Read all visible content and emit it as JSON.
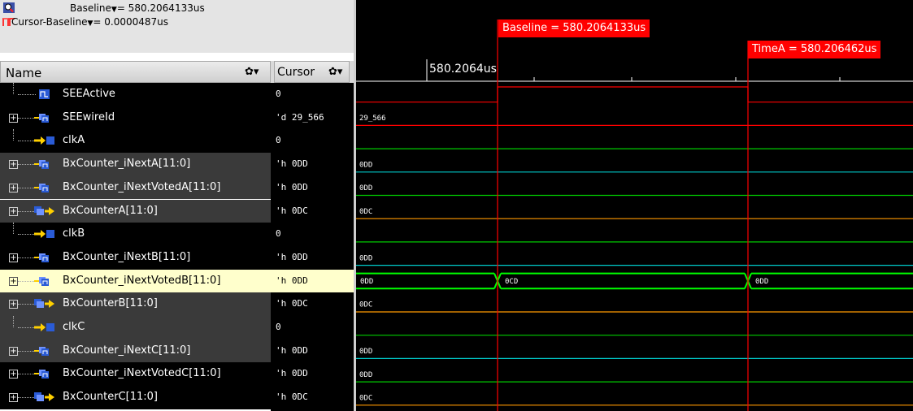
{
  "header": {
    "baseline_label": "Baseline",
    "baseline_value": "= 580.2064133us",
    "cursor_label": "Cursor-Baseline",
    "cursor_value": "= 0.0000487us"
  },
  "columns": {
    "name": "Name",
    "cursor": "Cursor"
  },
  "markers": {
    "baseline": "Baseline = 580.2064133us",
    "timeA": "TimeA = 580.206462us",
    "time_tick": "580.2064us"
  },
  "signals": [
    {
      "name": "SEEActive",
      "value": "0",
      "type": "bit",
      "expandable": false,
      "selected": false,
      "row_shade": "dark"
    },
    {
      "name": "SEEwireId",
      "value": "'d 29_566",
      "type": "bus",
      "expandable": true,
      "selected": false,
      "row_shade": "dark"
    },
    {
      "name": "clkA",
      "value": "0",
      "type": "clock",
      "expandable": false,
      "selected": false,
      "row_shade": "dark"
    },
    {
      "name": "BxCounter_iNextA[11:0]",
      "value": "'h 0DD",
      "type": "bus",
      "expandable": true,
      "selected": false,
      "row_shade": "mid"
    },
    {
      "name": "BxCounter_iNextVotedA[11:0]",
      "value": "'h 0DD",
      "type": "bus",
      "expandable": true,
      "selected": false,
      "row_shade": "mid"
    },
    {
      "name": "BxCounterA[11:0]",
      "value": "'h 0DC",
      "type": "reg",
      "expandable": true,
      "selected": false,
      "row_shade": "mid"
    },
    {
      "name": "clkB",
      "value": "0",
      "type": "clock",
      "expandable": false,
      "selected": false,
      "row_shade": "dark"
    },
    {
      "name": "BxCounter_iNextB[11:0]",
      "value": "'h 0DD",
      "type": "bus",
      "expandable": true,
      "selected": false,
      "row_shade": "dark"
    },
    {
      "name": "BxCounter_iNextVotedB[11:0]",
      "value": "'h 0DD",
      "type": "bus",
      "expandable": true,
      "selected": true,
      "row_shade": "selected"
    },
    {
      "name": "BxCounterB[11:0]",
      "value": "'h 0DC",
      "type": "reg",
      "expandable": true,
      "selected": false,
      "row_shade": "mid"
    },
    {
      "name": "clkC",
      "value": "0",
      "type": "clock",
      "expandable": false,
      "selected": false,
      "row_shade": "mid"
    },
    {
      "name": "BxCounter_iNextC[11:0]",
      "value": "'h 0DD",
      "type": "bus",
      "expandable": true,
      "selected": false,
      "row_shade": "mid"
    },
    {
      "name": "BxCounter_iNextVotedC[11:0]",
      "value": "'h 0DD",
      "type": "bus",
      "expandable": true,
      "selected": false,
      "row_shade": "dark"
    },
    {
      "name": "BxCounterC[11:0]",
      "value": "'h 0DC",
      "type": "reg",
      "expandable": true,
      "selected": false,
      "row_shade": "dark"
    }
  ],
  "waves": [
    {
      "kind": "bit",
      "color": "#ff0000"
    },
    {
      "kind": "bus",
      "color": "#ff0000",
      "labels": [
        "29_566"
      ]
    },
    {
      "kind": "flat",
      "color": "#00cc00"
    },
    {
      "kind": "bus",
      "color": "#00cccc",
      "labels": [
        "0DD"
      ]
    },
    {
      "kind": "bus",
      "color": "#00cc00",
      "labels": [
        "0DD"
      ]
    },
    {
      "kind": "bus",
      "color": "#ff9900",
      "labels": [
        "0DC"
      ]
    },
    {
      "kind": "flat",
      "color": "#00cc00"
    },
    {
      "kind": "bus",
      "color": "#00cccc",
      "labels": [
        "0DD"
      ]
    },
    {
      "kind": "bus-sel",
      "color": "#00ff00",
      "labels": [
        "0DD",
        "0CD",
        "0DD"
      ]
    },
    {
      "kind": "bus",
      "color": "#ff9900",
      "labels": [
        "0DC"
      ]
    },
    {
      "kind": "flat",
      "color": "#00cc00"
    },
    {
      "kind": "bus",
      "color": "#00cccc",
      "labels": [
        "0DD"
      ]
    },
    {
      "kind": "bus",
      "color": "#00cc00",
      "labels": [
        "0DD"
      ]
    },
    {
      "kind": "bus",
      "color": "#ff9900",
      "labels": [
        "0DC"
      ]
    }
  ],
  "colors": {
    "row_dark": "#000000",
    "row_mid": "#3a3a3a",
    "row_selected": "#ffffcc",
    "marker": "#ff0000"
  },
  "icons": {
    "header": [
      "magnifier-icon",
      "cursor-baseline-icon"
    ],
    "column": [
      "gear-icon",
      "dropdown-arrow-icon"
    ],
    "signals": [
      "bit-signal-icon",
      "bus-signal-icon",
      "clock-signal-icon",
      "register-signal-icon",
      "expand-plus-icon"
    ]
  }
}
